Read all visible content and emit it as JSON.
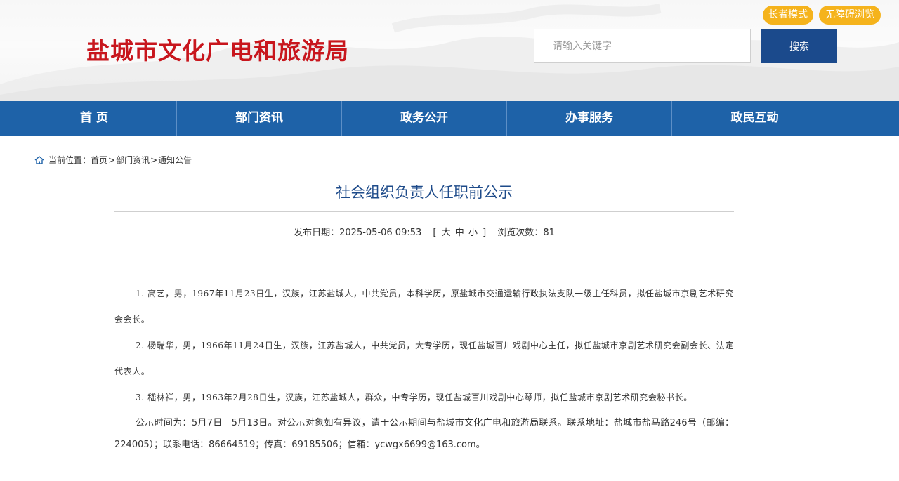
{
  "header": {
    "site_title": "盐城市文化广电和旅游局",
    "search_placeholder": "请输入关键字",
    "search_button": "搜索",
    "elder_mode": "长者模式",
    "accessibility": "无障碍浏览"
  },
  "nav": {
    "items": [
      "首 页",
      "部门资讯",
      "政务公开",
      "办事服务",
      "政民互动"
    ]
  },
  "breadcrumb": {
    "prefix": "当前位置：",
    "home": "首页",
    "section": "部门资讯",
    "current": "通知公告",
    "separator": ">"
  },
  "article": {
    "title": "社会组织负责人任职前公示",
    "date_label": "发布日期：",
    "date": "2025-05-06 09:53",
    "size_open": "[",
    "size_large": "大",
    "size_medium": "中",
    "size_small": "小",
    "size_close": "]",
    "views_label": "浏览次数：",
    "views": "81",
    "paragraphs": [
      "1. 高艺，男，1967年11月23日生，汉族，江苏盐城人，中共党员，本科学历，原盐城市交通运输行政执法支队一级主任科员，拟任盐城市京剧艺术研究会会长。",
      "2. 杨瑞华，男，1966年11月24日生，汉族，江苏盐城人，中共党员，大专学历，现任盐城百川戏剧中心主任，拟任盐城市京剧艺术研究会副会长、法定代表人。",
      "3. 嵇林祥，男，1963年2月28日生，汉族，江苏盐城人，群众，中专学历，现任盐城百川戏剧中心琴师，拟任盐城市京剧艺术研究会秘书长。"
    ],
    "notice": "公示时间为：5月7日—5月13日。对公示对象如有异议，请于公示期间与盐城市文化广电和旅游局联系。联系地址：盐城市盐马路246号（邮编：224005）；联系电话：86664519；传真：69185506；信箱：ycwgx6699@163.com。"
  },
  "colors": {
    "brand_red": "#c8161d",
    "nav_blue": "#1e62a8",
    "button_blue": "#1b4a8c",
    "pill_yellow": "#f5b31c",
    "title_blue": "#1e4b8a"
  }
}
